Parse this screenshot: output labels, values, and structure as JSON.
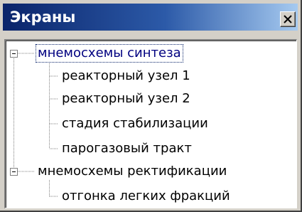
{
  "window": {
    "title": "Экраны",
    "close_icon": "close-icon"
  },
  "tree": {
    "groups": [
      {
        "label": "мнемосхемы синтеза",
        "expanded": true,
        "selected": true,
        "children": [
          {
            "label": "реакторный узел 1"
          },
          {
            "label": "реакторный узел 2"
          },
          {
            "label": "стадия стабилизации"
          },
          {
            "label": "парогазовый тракт"
          }
        ]
      },
      {
        "label": "мнемосхемы ректификации",
        "expanded": true,
        "selected": false,
        "children": [
          {
            "label": "отгонка легких фракций"
          }
        ]
      }
    ]
  },
  "colors": {
    "titlebar_start": "#0a246a",
    "titlebar_end": "#a6caf0",
    "selection_text": "#000080",
    "face": "#d4d0c8"
  }
}
